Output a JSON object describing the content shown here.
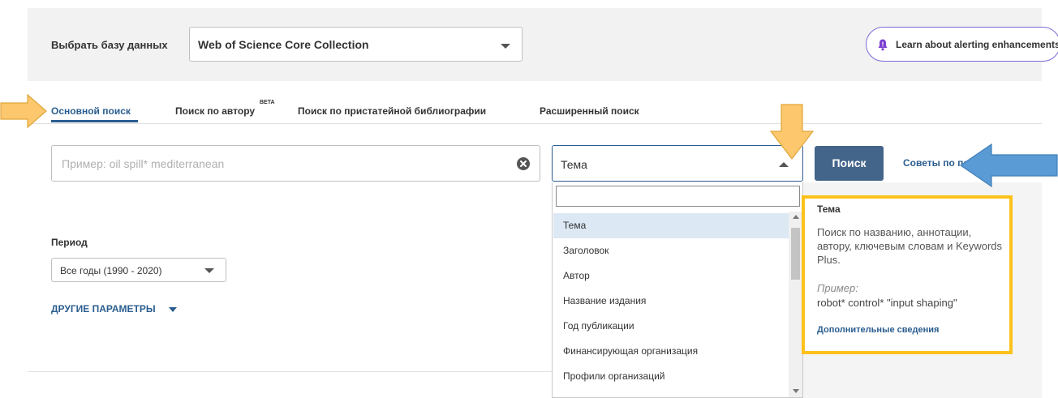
{
  "database": {
    "label": "Выбрать базу данных",
    "selected": "Web of Science Core Collection",
    "alert_button": "Learn about alerting enhancements"
  },
  "tabs": {
    "items": [
      {
        "label": "Основной поиск",
        "active": true
      },
      {
        "label": "Поиск по автору",
        "badge": "BETA"
      },
      {
        "label": "Поиск по пристатейной библиографии"
      },
      {
        "label": "Расширенный поиск"
      }
    ]
  },
  "search": {
    "placeholder": "Пример: oil spill* mediterranean",
    "value": "",
    "field": "Тема",
    "button": "Поиск",
    "tips": "Советы по поиску"
  },
  "field_dropdown": {
    "filter_value": "",
    "options": [
      "Тема",
      "Заголовок",
      "Автор",
      "Название издания",
      "Год публикации",
      "Финансирующая организация",
      "Профили организаций"
    ],
    "selected_index": 0
  },
  "info_panel": {
    "title": "Тема",
    "description": "Поиск по названию, аннотации, автору, ключевым словам и Keywords Plus.",
    "example_label": "Пример:",
    "example": "robot* control* \"input shaping\"",
    "more_link": "Дополнительные сведения"
  },
  "period": {
    "label": "Период",
    "selected": "Все годы (1990 - 2020)",
    "more_params": "ДРУГИЕ ПАРАМЕТРЫ"
  },
  "colors": {
    "accent": "#2a5d8f",
    "search_button": "#44658a",
    "highlight_box": "#fcc21b",
    "annotation_yellow": "#fcc76d",
    "annotation_blue": "#5b9bd5",
    "bell": "#7a3fd1"
  },
  "icons": {
    "alert": "bell-icon",
    "clear": "clear-icon",
    "dropdown": "caret-icon"
  }
}
